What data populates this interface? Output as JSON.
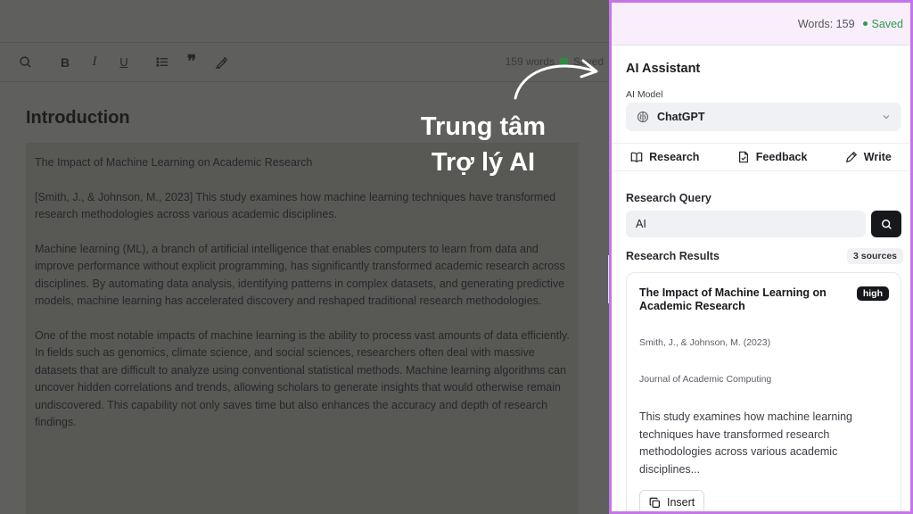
{
  "editor": {
    "status_words": "159 words",
    "status_saved": "Saved",
    "title": "Introduction",
    "paragraphs": [
      "The Impact of Machine Learning on Academic Research",
      "[Smith, J., & Johnson, M., 2023] This study examines how machine learning techniques have transformed research methodologies across various academic disciplines.",
      "Machine learning (ML), a branch of artificial intelligence that enables computers to learn from data and improve performance without explicit programming, has significantly transformed academic research across disciplines. By automating data analysis, identifying patterns in complex datasets, and generating predictive models, machine learning has accelerated discovery and reshaped traditional research methodologies.",
      "One of the most notable impacts of machine learning is the ability to process vast amounts of data efficiently. In fields such as genomics, climate science, and social sciences, researchers often deal with massive datasets that are difficult to analyze using conventional statistical methods. Machine learning algorithms can uncover hidden correlations and trends, allowing scholars to generate insights that would otherwise remain undiscovered. This capability not only saves time but also enhances the accuracy and depth of research findings."
    ],
    "toolbar_icons": [
      "search-icon",
      "bold-icon",
      "italic-icon",
      "underline-icon",
      "list-icon",
      "quote-icon",
      "highlight-icon"
    ]
  },
  "callout": {
    "line1": "Trung tâm",
    "line2": "Trợ lý AI"
  },
  "panel": {
    "words": "Words: 159",
    "saved": "Saved",
    "title": "AI Assistant",
    "model_label": "AI Model",
    "model_value": "ChatGPT",
    "tabs": [
      {
        "label": "Research",
        "icon": "book-icon"
      },
      {
        "label": "Feedback",
        "icon": "document-check-icon"
      },
      {
        "label": "Write",
        "icon": "pencil-icon"
      }
    ],
    "query_label": "Research Query",
    "query_value": "AI",
    "results_label": "Research Results",
    "results_count": "3 sources",
    "result": {
      "title": "The Impact of Machine Learning on Academic Research",
      "badge": "high",
      "authors": "Smith, J., & Johnson, M. (2023)",
      "journal": "Journal of Academic Computing",
      "abstract": "This study examines how machine learning techniques have transformed research methodologies across various academic disciplines...",
      "insert_label": "Insert"
    }
  },
  "colors": {
    "panel_border": "#c576e6",
    "saved_green": "#2e9b4b",
    "overlay": "#5f605d"
  }
}
